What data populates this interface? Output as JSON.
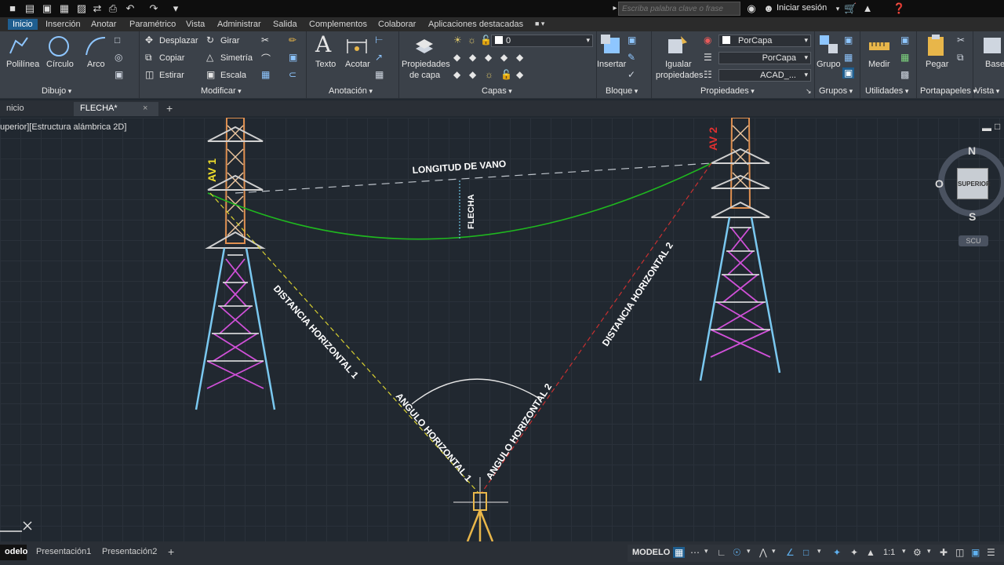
{
  "search": {
    "placeholder": "Escriba palabra clave o frase"
  },
  "user": {
    "signin_label": "Iniciar sesión"
  },
  "ribbon_tabs": [
    "Inicio",
    "Inserción",
    "Anotar",
    "Paramétrico",
    "Vista",
    "Administrar",
    "Salida",
    "Complementos",
    "Colaborar",
    "Aplicaciones destacadas"
  ],
  "ribbon": {
    "dibujo": {
      "title": "Dibujo",
      "polilinea": "Polilínea",
      "circulo": "Círculo",
      "arco": "Arco"
    },
    "modificar": {
      "title": "Modificar",
      "desplazar": "Desplazar",
      "girar": "Girar",
      "copiar": "Copiar",
      "simetria": "Simetría",
      "estirar": "Estirar",
      "escala": "Escala"
    },
    "anotacion": {
      "title": "Anotación",
      "texto": "Texto",
      "acotar": "Acotar"
    },
    "capas": {
      "title": "Capas",
      "prop_line1": "Propiedades",
      "prop_line2": "de capa",
      "layer_value": "0"
    },
    "bloque": {
      "title": "Bloque",
      "insertar": "Insertar"
    },
    "propiedades": {
      "title": "Propiedades",
      "igualar_line1": "Igualar",
      "igualar_line2": "propiedades",
      "color": "PorCapa",
      "linetype": "PorCapa",
      "lineweight": "ACAD_..."
    },
    "grupos": {
      "title": "Grupos",
      "grupo": "Grupo"
    },
    "utilidades": {
      "title": "Utilidades",
      "medir": "Medir"
    },
    "portapapeles": {
      "title": "Portapapeles",
      "pegar": "Pegar"
    },
    "vista": {
      "title": "Vista",
      "base": "Base"
    }
  },
  "doc_tabs": [
    {
      "label": "nicio"
    },
    {
      "label": "FLECHA*"
    }
  ],
  "viewport": {
    "label": "uperior][Estructura alámbrica 2D]"
  },
  "drawing": {
    "av1": "AV 1",
    "av2": "AV 2",
    "longitud": "LONGITUD DE VANO",
    "flecha": "FLECHA",
    "dist1": "DISTANCIA HORIZONTAL 1",
    "dist2": "DISTANCIA HORIZONTAL 2",
    "ang1": "ANGULO HORIZONTAL 1",
    "ang2": "ANGULO HORIZONTAL 2"
  },
  "viewcube": {
    "north": "N",
    "south": "S",
    "west": "O",
    "face": "SUPERIOR",
    "ucs": "SCU"
  },
  "layout_tabs": [
    "odelo",
    "Presentación1",
    "Presentación2"
  ],
  "status": {
    "model": "MODELO",
    "scale": "1:1"
  },
  "colors": {
    "accent": "#1f5e8f",
    "canvas": "#212830",
    "av1": "#f2e12b",
    "av2": "#e03030",
    "catenary": "#1fb81f"
  }
}
